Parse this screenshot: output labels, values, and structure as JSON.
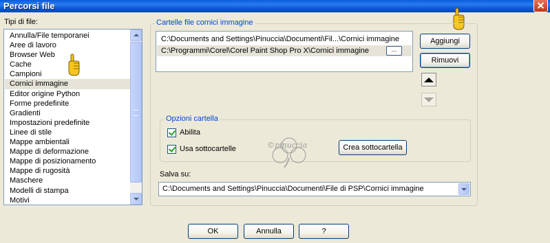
{
  "window": {
    "title": "Percorsi file"
  },
  "file_types": {
    "label": "Tipi di file:",
    "items": [
      "Annulla/File temporanei",
      "Aree di lavoro",
      "Browser Web",
      "Cache",
      "Campioni",
      "Cornici immagine",
      "Editor origine Python",
      "Forme predefinite",
      "Gradienti",
      "Impostazioni predefinite",
      "Linee di stile",
      "Mappe ambientali",
      "Mappe di deformazione",
      "Mappe di posizionamento",
      "Mappe di rugosità",
      "Maschere",
      "Modelli di stampa",
      "Motivi"
    ],
    "selected": "Cornici immagine"
  },
  "folders": {
    "title": "Cartelle file cornici immagine",
    "paths": [
      "C:\\Documents and Settings\\Pinuccia\\Documenti\\Fil...\\Cornici immagine",
      "C:\\Programmi\\Corel\\Corel Paint Shop Pro X\\Cornici immagine"
    ],
    "browse_label": "...",
    "add_label": "Aggiungi",
    "remove_label": "Rimuovi"
  },
  "folder_options": {
    "title": "Opzioni cartella",
    "enable_label": "Abilita",
    "enable_checked": true,
    "subfolders_label": "Usa sottocartelle",
    "subfolders_checked": true,
    "create_subfolder_label": "Crea sottocartella"
  },
  "save_to": {
    "label": "Salva su:",
    "value": "C:\\Documents and Settings\\Pinuccia\\Documenti\\File di PSP\\Cornici immagine"
  },
  "footer": {
    "ok_label": "OK",
    "cancel_label": "Annulla",
    "help_label": "?"
  },
  "watermark": {
    "text": "©pinuccia"
  },
  "colors": {
    "title_bar": "#0a5bd8",
    "dialog_bg": "#ece9d8",
    "group_title": "#0046d5",
    "selection": "#e6e3d8"
  }
}
